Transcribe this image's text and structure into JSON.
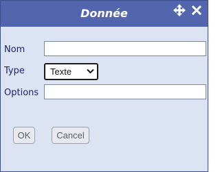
{
  "dialog": {
    "title": "Donnée",
    "move_icon": "move-arrows-icon",
    "close_icon": "close-icon"
  },
  "form": {
    "nom_label": "Nom",
    "nom_value": "",
    "type_label": "Type",
    "type_selected": "Texte",
    "options_label": "Options",
    "options_value": ""
  },
  "buttons": {
    "ok_label": "OK",
    "cancel_label": "Cancel"
  },
  "colors": {
    "titlebar": "#5366ad",
    "dialog_bg": "#dce3f3",
    "label_text": "#1b1f7a",
    "title_text": "#ffffff"
  }
}
